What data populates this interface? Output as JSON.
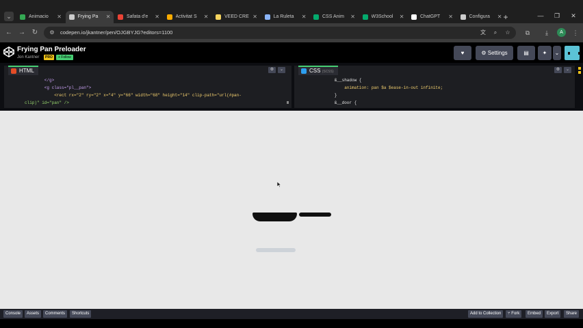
{
  "browser": {
    "tabs": [
      {
        "label": "Animacio",
        "color": "#34a853"
      },
      {
        "label": "Frying Pa",
        "color": "#cccccc",
        "active": true
      },
      {
        "label": "Safata d'e",
        "color": "#ea4335"
      },
      {
        "label": "Activitat S",
        "color": "#f9ab00"
      },
      {
        "label": "VEED CRE",
        "color": "#f4d35e"
      },
      {
        "label": "La Ruleta",
        "color": "#8ab4f8"
      },
      {
        "label": "CSS Anim",
        "color": "#04aa6d"
      },
      {
        "label": "W3School",
        "color": "#04aa6d"
      },
      {
        "label": "ChatGPT",
        "color": "#ffffff"
      },
      {
        "label": "Configura",
        "color": "#cccccc"
      }
    ],
    "new_tab": "+",
    "url": "codepen.io/jkantner/pen/OJGBYJG?editors=1100",
    "profile_initial": "A"
  },
  "header": {
    "title": "Frying Pan Preloader",
    "author": "Jon Kantner",
    "pro_badge": "PRO",
    "follow": "+ Follow",
    "settings": "Settings"
  },
  "editors": {
    "html": {
      "label": "HTML",
      "color": "#e34c26",
      "lines": [
        "        </g>",
        "        <g class=\"pl__pan\">",
        "            <rect rx=\"2\" ry=\"2\" x=\"4\" y=\"66\" width=\"68\" height=\"14\" clip-path=\"url(#pan-",
        "clip)\" id=\"pan\" />"
      ]
    },
    "css": {
      "label": "CSS",
      "sublabel": "(SCSS)",
      "color": "#2d9ff0",
      "lines": [
        "        &__shadow {",
        "            animation: pan $a $ease-in-out infinite;",
        "        }",
        "        &__door {"
      ]
    }
  },
  "footer": {
    "left": [
      "Console",
      "Assets",
      "Comments",
      "Shortcuts"
    ],
    "right": [
      "Add to Collection",
      "Fork",
      "Embed",
      "Export",
      "Share"
    ]
  }
}
